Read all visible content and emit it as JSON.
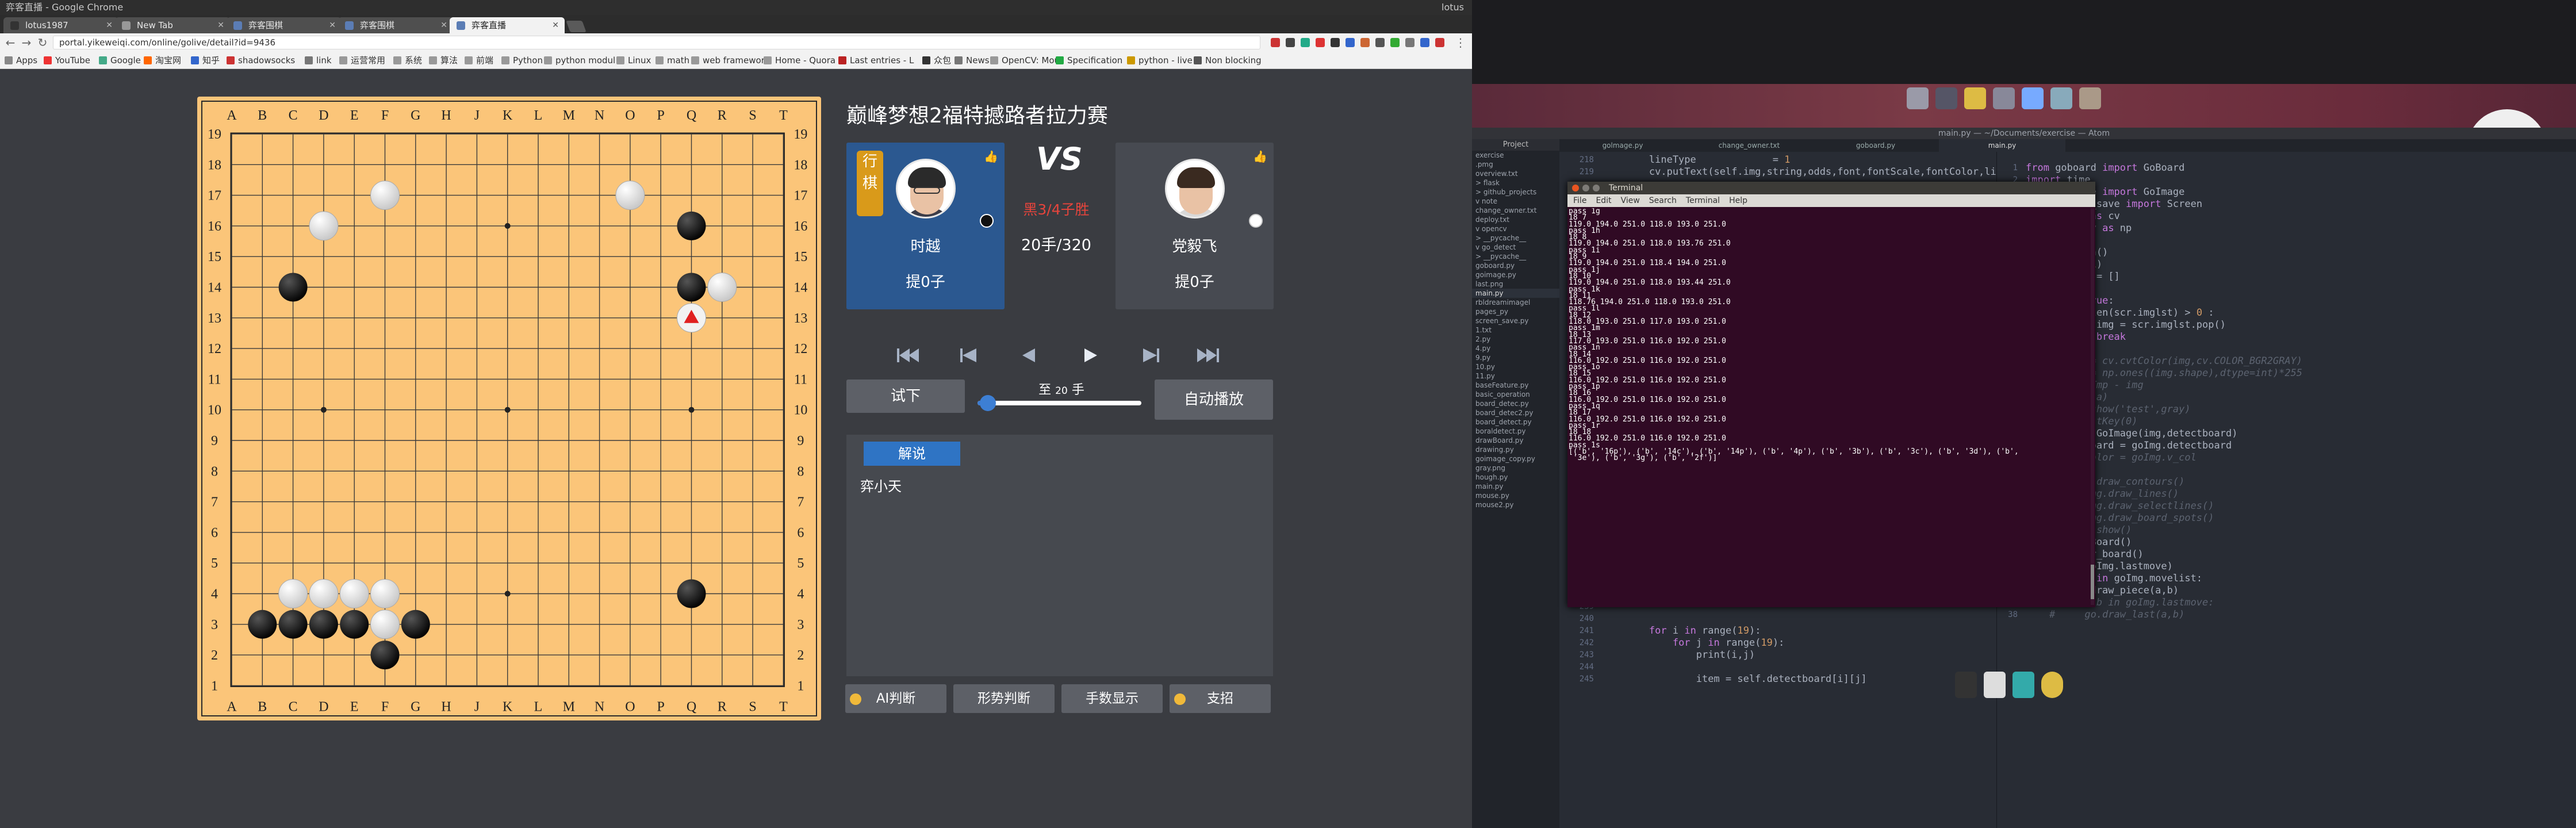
{
  "browser": {
    "window_title": "弈客直播 - Google Chrome",
    "user": "lotus",
    "tabs": [
      {
        "label": "lotus1987"
      },
      {
        "label": "New Tab"
      },
      {
        "label": "弈客围棋"
      },
      {
        "label": "弈客围棋"
      },
      {
        "label": "弈客直播"
      }
    ],
    "url": "portal.yikeweiqi.com/online/golive/detail?id=9436",
    "bookmarks": [
      "Apps",
      "YouTube",
      "Google",
      "淘宝网",
      "知乎",
      "shadowsocks",
      "link",
      "运营常用",
      "系统",
      "算法",
      "前端",
      "Python",
      "python modul",
      "Linux",
      "math",
      "web framework",
      "Home - Quora",
      "Last entries - L",
      "众包",
      "News",
      "OpenCV: Mou",
      "Specification",
      "python - live",
      "Non blocking"
    ]
  },
  "game": {
    "title": "巅峰梦想2福特撼路者拉力赛",
    "black_player": {
      "name": "时越",
      "captures": "提0子",
      "seal": "行棋"
    },
    "white_player": {
      "name": "党毅飞",
      "captures": "提0子"
    },
    "vs": "VS",
    "result": "黑3/4子胜",
    "move_count": "20手/320",
    "try_button": "试下",
    "auto_play_button": "自动播放",
    "slider_prefix": "至",
    "slider_value": "20",
    "slider_suffix": "手",
    "slider_progress": 0.0625,
    "commentary_tab": "解说",
    "commentator": "弈小天",
    "tools": [
      "AI判断",
      "形势判断",
      "手数显示",
      "支招"
    ],
    "cols": [
      "A",
      "B",
      "C",
      "D",
      "E",
      "F",
      "G",
      "H",
      "J",
      "K",
      "L",
      "M",
      "N",
      "O",
      "P",
      "Q",
      "R",
      "S",
      "T"
    ],
    "rows": [
      "19",
      "18",
      "17",
      "16",
      "15",
      "14",
      "13",
      "12",
      "11",
      "10",
      "9",
      "8",
      "7",
      "6",
      "5",
      "4",
      "3",
      "2",
      "1"
    ],
    "black_stones": [
      "Q16",
      "Q14",
      "C14",
      "Q13",
      "Q4",
      "B3",
      "C3",
      "D3",
      "E3",
      "G3",
      "F2"
    ],
    "white_stones": [
      "F17",
      "O17",
      "D16",
      "R14",
      "C4",
      "D4",
      "E4",
      "F4",
      "F3"
    ],
    "last_move": "Q13",
    "colors": {
      "board": "#fbc579",
      "black_card": "#2b5890",
      "result": "#e6443c",
      "accent": "#3c7bd0"
    }
  },
  "atom": {
    "window_title": "main.py — ~/Documents/exercise — Atom",
    "project_header": "Project",
    "files": [
      "exercise",
      "  .pmg",
      "  overview.txt",
      "> flask",
      "> github_projects",
      "v note",
      "    change_owner.txt",
      "    deploy.txt",
      "v opencv",
      "  > __pycache__",
      "  v go_detect",
      "    > __pycache__",
      "      goboard.py",
      "      goimage.py",
      "      last.png",
      "      main.py",
      "      rbldreamimagel",
      "      pages_py",
      "      screen_save.py",
      "    1.txt",
      "    2.py",
      "    4.py",
      "    9.py",
      "    10.py",
      "    11.py",
      "    baseFeature.py",
      "    basic_operation",
      "    board_detec.py",
      "    board_detec2.py",
      "    board_detect.py",
      "    boraldetect.py",
      "    drawBoard.py",
      "    drawing.py",
      "    goimage_copy.py",
      "    gray.png",
      "    hough.py",
      "    main.py",
      "    mouse.py",
      "    mouse2.py"
    ],
    "tabs": [
      "golmage.py",
      "change_owner.txt",
      "goboard.py",
      "main.py"
    ],
    "editor1_lines": [
      {
        "no": "218",
        "text": "        lineType             = 1"
      },
      {
        "no": "219",
        "text": "        cv.putText(self.img,string,odds,font,fontScale,fontColor,line"
      },
      {
        "no": "238",
        "text": ""
      },
      {
        "no": "239",
        "text": ""
      },
      {
        "no": "240",
        "text": ""
      },
      {
        "no": "241",
        "text": "        for i in range(19):"
      },
      {
        "no": "242",
        "text": "            for j in range(19):"
      },
      {
        "no": "243",
        "text": "                print(i,j)"
      },
      {
        "no": "244",
        "text": ""
      },
      {
        "no": "245",
        "text": "                item = self.detectboard[i][j]"
      }
    ],
    "editor2_lines": [
      {
        "no": "1",
        "text": "from goboard import GoBoard"
      },
      {
        "no": "2",
        "text": "import time"
      },
      {
        "no": "3",
        "text": "from goImage import GoImage"
      },
      {
        "no": "4",
        "text": "from screen_save import Screen"
      },
      {
        "no": "5",
        "text": "import cv2 as cv"
      },
      {
        "no": "6",
        "text": "import numpy as np"
      },
      {
        "no": "7",
        "text": ""
      },
      {
        "no": "8",
        "text": "scr = Screen()"
      },
      {
        "no": "9",
        "text": "scr.run(0.01)"
      },
      {
        "no": "10",
        "text": "detectboard = []"
      },
      {
        "no": "11",
        "text": "while True:"
      },
      {
        "no": "12",
        "text": "    while True:"
      },
      {
        "no": "13",
        "text": "        if len(scr.imglst) > 0 :"
      },
      {
        "no": "14",
        "text": "            img = scr.imglst.pop()"
      },
      {
        "no": "15",
        "text": "            break"
      },
      {
        "no": "16",
        "text": ""
      },
      {
        "no": "17",
        "text": "    # gray = cv.cvtColor(img,cv.COLOR_BGR2GRAY)"
      },
      {
        "no": "18",
        "text": "    # iTmp = np.ones((img.shape),dtype=int)*255"
      },
      {
        "no": "19",
        "text": "    # a = iTmp - img"
      },
      {
        "no": "20",
        "text": "    # print(a)"
      },
      {
        "no": "21",
        "text": "    # cv.imshow('test',gray)"
      },
      {
        "no": "22",
        "text": "    # cv.waitKey(0)"
      },
      {
        "no": "23",
        "text": "    goImg = GoImage(img,detectboard)"
      },
      {
        "no": "24",
        "text": "    detectboard = goImg.detectboard"
      },
      {
        "no": "25",
        "text": "    # vag_color = goImg.v_col"
      },
      {
        "no": "26",
        "text": "    #"
      },
      {
        "no": "27",
        "text": "    # goImg.draw_contours()"
      },
      {
        "no": "28",
        "text": "    # # goImg.draw_lines()"
      },
      {
        "no": "29",
        "text": "    # # goImg.draw_selectlines()"
      },
      {
        "no": "30",
        "text": "    # # goImg.draw_board_spots()"
      },
      {
        "no": "31",
        "text": "    # goImg.show()"
      },
      {
        "no": "32",
        "text": "    go = GoBoard()"
      },
      {
        "no": "33",
        "text": "    go.clear_board()"
      },
      {
        "no": "34",
        "text": "    print(goImg.lastmove)"
      },
      {
        "no": "35",
        "text": "    for a,b in goImg.movelist:"
      },
      {
        "no": "36",
        "text": "        go.draw_piece(a,b)"
      },
      {
        "no": "37",
        "text": "    # for a,b in goImg.lastmove:"
      },
      {
        "no": "38",
        "text": "    #     go.draw_last(a,b)"
      }
    ]
  },
  "terminal": {
    "title": "Terminal",
    "menu": [
      "File",
      "Edit",
      "View",
      "Search",
      "Terminal",
      "Help"
    ],
    "lines": [
      "pass 1g",
      "18 7",
      "119.0 194.0 251.0 118.0 193.0 251.0",
      "pass 1h",
      "18 8",
      "119.0 194.0 251.0 118.0 193.76 251.0",
      "pass 1i",
      "18 9",
      "119.0 194.0 251.0 118.4 194.0 251.0",
      "pass 1j",
      "18 10",
      "119.0 194.0 251.0 118.0 193.44 251.0",
      "pass 1k",
      "18 11",
      "118.76 194.0 251.0 118.0 193.0 251.0",
      "pass 1l",
      "18 12",
      "118.0 193.0 251.0 117.0 193.0 251.0",
      "pass 1m",
      "18 13",
      "117.0 193.0 251.0 116.0 192.0 251.0",
      "pass 1n",
      "18 14",
      "116.0 192.0 251.0 116.0 192.0 251.0",
      "pass 1o",
      "18 15",
      "116.0 192.0 251.0 116.0 192.0 251.0",
      "pass 1p",
      "18 16",
      "116.0 192.0 251.0 116.0 192.0 251.0",
      "pass 1q",
      "18 17",
      "116.0 192.0 251.0 116.0 192.0 251.0",
      "pass 1r",
      "18 18",
      "116.0 192.0 251.0 116.0 192.0 251.0",
      "pass 1s",
      "[('b', '16p'), ('b', '14c'), ('b', '14p'), ('b', '4p'), ('b', '3b'), ('b', '3c'), ('b', '3d'), ('b',",
      " '3e'), ('b', '3g'), ('b', '2f')]"
    ]
  }
}
